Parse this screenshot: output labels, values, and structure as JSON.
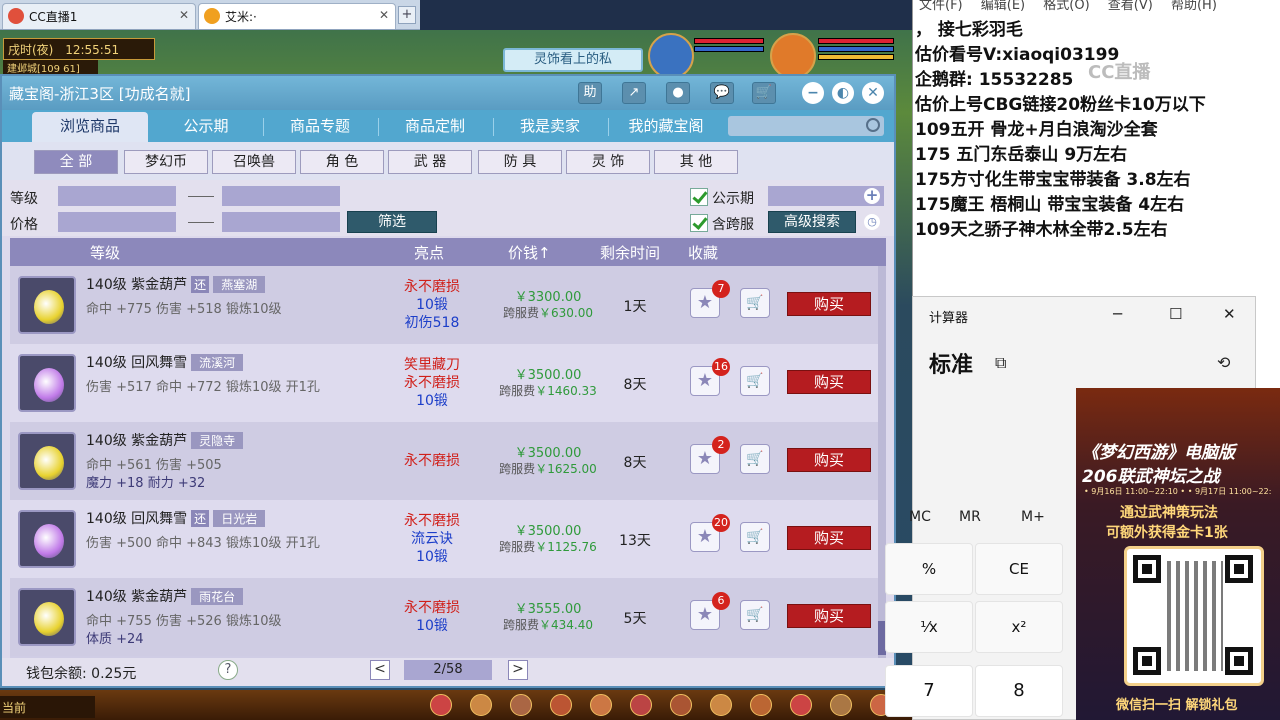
{
  "browser": {
    "tabs": [
      {
        "title": "CC直播1",
        "close": "✕"
      },
      {
        "title": "艾米:·",
        "close": "✕"
      }
    ],
    "new_tab": "+"
  },
  "game_hud": {
    "time_label": "戌时(夜)",
    "clock": "12:55:51",
    "location": "建邺城[109 61]",
    "banner": "灵饰看上的私",
    "bottom_left": "当前"
  },
  "dialog": {
    "title": "藏宝阁-浙江3区 [功成名就]",
    "title_icons": [
      "助",
      "↗",
      "●",
      "💬",
      "🛒"
    ],
    "window_controls": [
      "−",
      "◐",
      "✕"
    ],
    "nav_tabs": [
      "浏览商品",
      "公示期",
      "商品专题",
      "商品定制",
      "我是卖家",
      "我的藏宝阁"
    ],
    "categories": [
      "全 部",
      "梦幻币",
      "召唤兽",
      "角 色",
      "武 器",
      "防 具",
      "灵 饰",
      "其 他"
    ],
    "filters": {
      "level_label": "等级",
      "price_label": "价格",
      "filter_button": "筛选",
      "public_label": "公示期",
      "cross_label": "含跨服",
      "advanced_button": "高级搜索"
    },
    "table_headers": {
      "level": "等级",
      "highlight": "亮点",
      "price": "价钱↑",
      "remaining": "剩余时间",
      "favorite": "收藏"
    },
    "rows": [
      {
        "name": "140级  紫金葫芦",
        "huan": "还",
        "server": "燕塞湖",
        "attr1": "命中 +775 伤害 +518 锻炼10级",
        "attr2": "",
        "hl": [
          "永不磨损",
          "10锻",
          "初伤518"
        ],
        "hl_colors": [
          "#d0201a",
          "#1c3ec9",
          "#1c3ec9"
        ],
        "price": "￥3300.00",
        "cross_label": "跨服费",
        "cross_price": "￥630.00",
        "days": "1天",
        "fav": "7",
        "buy": "购买",
        "icon_color": "#e8d22e"
      },
      {
        "name": "140级  回风舞雪",
        "huan": "",
        "server": "流溪河",
        "attr1": "伤害 +517 命中 +772 锻炼10级 开1孔",
        "attr2": "",
        "hl": [
          "笑里藏刀",
          "永不磨损",
          "10锻"
        ],
        "hl_colors": [
          "#d0201a",
          "#d0201a",
          "#1c3ec9"
        ],
        "price": "￥3500.00",
        "cross_label": "跨服费",
        "cross_price": "￥1460.33",
        "days": "8天",
        "fav": "16",
        "buy": "购买",
        "icon_color": "#c07ae8"
      },
      {
        "name": "140级  紫金葫芦",
        "huan": "",
        "server": "灵隐寺",
        "attr1": "命中 +561 伤害 +505",
        "attr2": "魔力 +18 耐力 +32",
        "hl": [
          "永不磨损"
        ],
        "hl_colors": [
          "#d0201a"
        ],
        "price": "￥3500.00",
        "cross_label": "跨服费",
        "cross_price": "￥1625.00",
        "days": "8天",
        "fav": "2",
        "buy": "购买",
        "icon_color": "#e8d22e"
      },
      {
        "name": "140级  回风舞雪",
        "huan": "还",
        "server": "日光岩",
        "attr1": "伤害 +500 命中 +843 锻炼10级 开1孔",
        "attr2": "",
        "hl": [
          "永不磨损",
          "流云诀",
          "10锻"
        ],
        "hl_colors": [
          "#d0201a",
          "#1c3ec9",
          "#1c3ec9"
        ],
        "price": "￥3500.00",
        "cross_label": "跨服费",
        "cross_price": "￥1125.76",
        "days": "13天",
        "fav": "20",
        "buy": "购买",
        "icon_color": "#c07ae8"
      },
      {
        "name": "140级  紫金葫芦",
        "huan": "",
        "server": "雨花台",
        "attr1": "命中 +755 伤害 +526 锻炼10级",
        "attr2": "体质 +24",
        "hl": [
          "永不磨损",
          "10锻"
        ],
        "hl_colors": [
          "#d0201a",
          "#1c3ec9"
        ],
        "price": "￥3555.00",
        "cross_label": "跨服费",
        "cross_price": "￥434.40",
        "days": "5天",
        "fav": "6",
        "buy": "购买",
        "icon_color": "#e8d22e"
      }
    ],
    "wallet": "钱包余额: 0.25元",
    "help": "?",
    "pager": {
      "prev": "<",
      "page": "2/58",
      "next": ">"
    }
  },
  "notepad": {
    "menu": [
      "文件(F)",
      "编辑(E)",
      "格式(O)",
      "查看(V)",
      "帮助(H)"
    ],
    "lines": [
      "，     接七彩羽毛",
      "估价看号V:xiaoqi03199",
      "企鹅群:  15532285",
      "估价上号CBG链接20粉丝卡10万以下",
      "109五开 骨龙+月白浪淘沙全套",
      "175 五门东岳泰山  9万左右",
      "175方寸化生带宝宝带装备  3.8左右",
      "175魔王 梧桐山  带宝宝装备 4左右",
      "109天之骄子神木林全带2.5左右"
    ]
  },
  "watermark": "CC直播",
  "calculator": {
    "title": "计算器",
    "controls": [
      "─",
      "☐",
      "✕"
    ],
    "mode": "标准",
    "memory": [
      "MC",
      "MR",
      "M+"
    ],
    "keys": [
      "%",
      "CE",
      "⅟x",
      "x²",
      "7",
      "8"
    ]
  },
  "ad": {
    "line1": "《梦幻西游》电脑版",
    "line2": "206联武神坛之战",
    "dates": "• 9月16日 11:00~22:10 •   • 9月17日 11:00~22:",
    "line3": "通过武神策玩法",
    "line4": "可额外获得金卡1张",
    "footer": "微信扫一扫 解锁礼包"
  }
}
